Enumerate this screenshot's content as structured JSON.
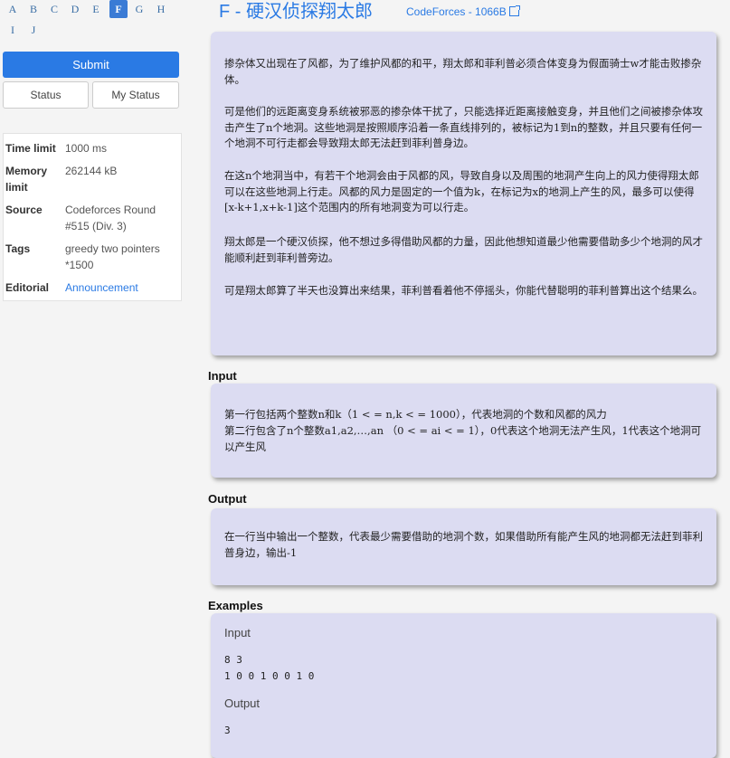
{
  "problem_letters": [
    "A",
    "B",
    "C",
    "D",
    "E",
    "F",
    "G",
    "H",
    "I",
    "J"
  ],
  "active_letter": "F",
  "buttons": {
    "submit": "Submit",
    "status": "Status",
    "my_status": "My Status"
  },
  "info": {
    "time_limit_label": "Time limit",
    "time_limit": "1000 ms",
    "memory_limit_label": "Memory limit",
    "memory_limit": "262144 kB",
    "source_label": "Source",
    "source": "Codeforces Round #515 (Div. 3)",
    "tags_label": "Tags",
    "tags": "greedy two pointers *1500",
    "editorial_label": "Editorial",
    "editorial": "Announcement"
  },
  "header": {
    "title": "F - 硬汉侦探翔太郎",
    "source_link": "CodeForces - 1066B"
  },
  "description": [
    "掺杂体又出现在了风都，为了维护风都的和平，翔太郎和菲利普必须合体变身为假面骑士w才能击败掺杂体。",
    "可是他们的远距离变身系统被邪恶的掺杂体干扰了，只能选择近距离接触变身，并且他们之间被掺杂体攻击产生了n个地洞。这些地洞是按照顺序沿着一条直线排列的，被标记为1到n的整数，并且只要有任何一个地洞不可行走都会导致翔太郎无法赶到菲利普身边。",
    "在这n个地洞当中，有若干个地洞会由于风都的风，导致自身以及周围的地洞产生向上的风力使得翔太郎可以在这些地洞上行走。风都的风力是固定的一个值为k，在标记为x的地洞上产生的风，最多可以使得[x-k+1,x+k-1]这个范围内的所有地洞变为可以行走。",
    "翔太郎是一个硬汉侦探，他不想过多得借助风都的力量，因此他想知道最少他需要借助多少个地洞的风才能顺利赶到菲利普旁边。",
    "可是翔太郎算了半天也没算出来结果，菲利普看着他不停摇头，你能代替聪明的菲利普算出这个结果么。"
  ],
  "input_section": {
    "title": "Input",
    "lines": [
      "第一行包括两个整数n和k（1 < = n,k < = 1000），代表地洞的个数和风都的风力",
      "第二行包含了n个整数a1,a2,…,an （0 < = ai < = 1），0代表这个地洞无法产生风，1代表这个地洞可以产生风"
    ]
  },
  "output_section": {
    "title": "Output",
    "text": "在一行当中输出一个整数，代表最少需要借助的地洞个数，如果借助所有能产生风的地洞都无法赶到菲利普身边，输出-1"
  },
  "examples": {
    "title": "Examples",
    "input_label": "Input",
    "input_lines": [
      "8 3",
      "1 0 0 1 0 0 1 0"
    ],
    "output_label": "Output",
    "output_lines": [
      "3"
    ]
  },
  "colors": {
    "accent": "#2a7ae4",
    "panel": "#dcdcf2",
    "background": "#f4f4f4"
  }
}
